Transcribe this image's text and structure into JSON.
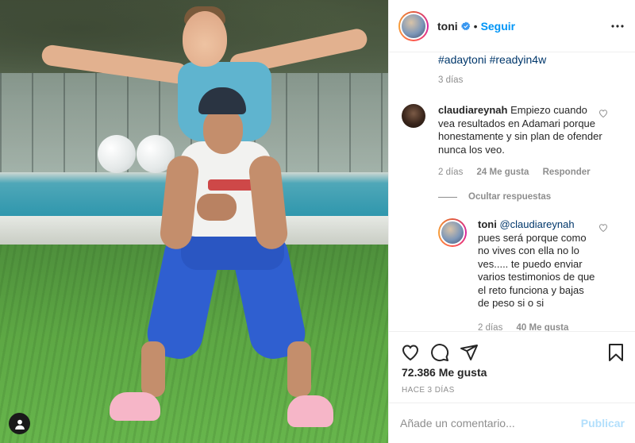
{
  "post": {
    "author": "toni",
    "follow_label": "Seguir",
    "separator": "•",
    "caption": {
      "hashtags": "#adaytoni #readyin4w",
      "time": "3 días"
    }
  },
  "comments": [
    {
      "user": "claudiareynah",
      "text": "Empiezo cuando vea resultados en Adamari porque honestamente y sin plan de ofender nunca los veo.",
      "time": "2 días",
      "likes": "24 Me gusta",
      "reply_label": "Responder",
      "hide_replies_label": "Ocultar respuestas",
      "replies": [
        {
          "user": "toni",
          "mention": "@claudiareynah",
          "text": "pues será porque como no vives con ella no lo ves..... te puedo enviar varios testimonios de que el reto funciona y bajas de peso si o si",
          "time": "2 días",
          "likes": "40 Me gusta"
        }
      ]
    }
  ],
  "stats": {
    "likes": "72.386 Me gusta",
    "date": "HACE 3 DÍAS"
  },
  "comment_box": {
    "placeholder": "Añade un comentario...",
    "publish_label": "Publicar"
  },
  "icons": {
    "verified": "verified-badge-icon",
    "more": "more-options-icon",
    "heart": "heart-icon",
    "comment": "comment-icon",
    "share": "share-icon",
    "save": "bookmark-icon",
    "user_tag": "user-tag-icon"
  },
  "colors": {
    "link": "#00376b",
    "accent": "#0095f6",
    "muted": "#8e8e8e",
    "text": "#262626"
  }
}
